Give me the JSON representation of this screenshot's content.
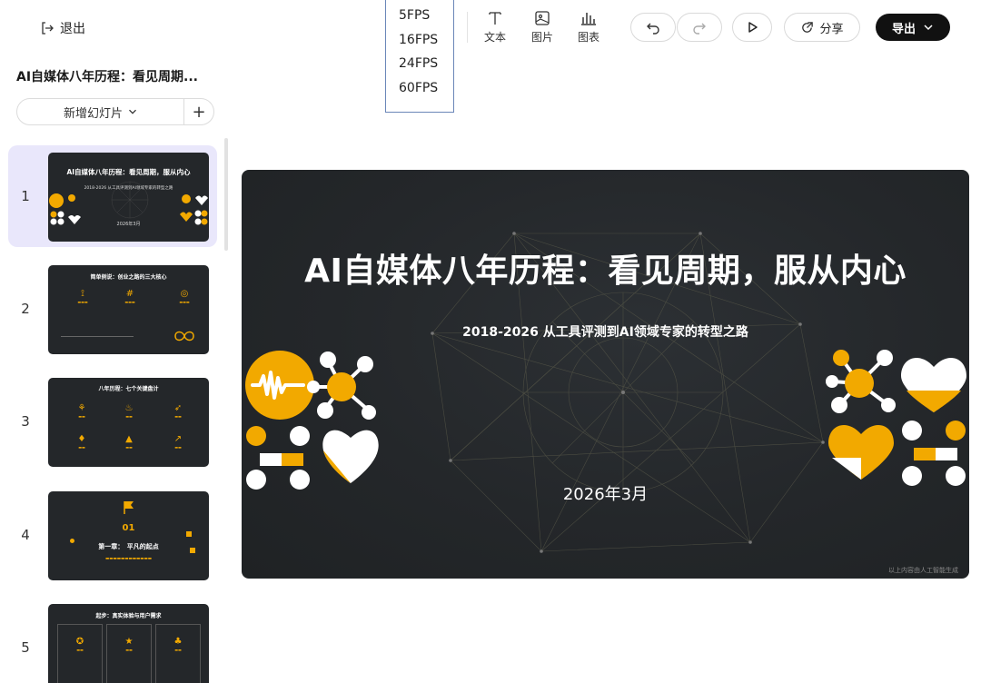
{
  "header": {
    "exit_label": "退出"
  },
  "document": {
    "title": "AI自媒体八年历程：看见周期..."
  },
  "add_slide": {
    "label": "新增幻灯片",
    "plus": "+"
  },
  "fps_menu": {
    "options": [
      "5FPS",
      "16FPS",
      "24FPS",
      "60FPS"
    ]
  },
  "toolbar": {
    "text_label": "文本",
    "image_label": "图片",
    "chart_label": "图表",
    "share_label": "分享",
    "export_label": "导出"
  },
  "slides": [
    {
      "number": "1",
      "title": "AI自媒体八年历程：看见周期，服从内心",
      "subtitle": "2018-2026 从工具评测到AI领域专家的转型之路",
      "date": "2026年3月",
      "selected": true
    },
    {
      "number": "2",
      "title": "简单例说：创业之路的三大核心"
    },
    {
      "number": "3",
      "title": "八年历程：七个关键盘计"
    },
    {
      "number": "4",
      "title": "第一章：　平凡的起点",
      "chapter": "01"
    },
    {
      "number": "5",
      "title": "起步：真实体验与用户需求"
    }
  ],
  "main_slide": {
    "title": "AI自媒体八年历程：看见周期，服从内心",
    "subtitle": "2018-2026 从工具评测到AI领域专家的转型之路",
    "date": "2026年3月",
    "watermark": "以上内容由人工智能生成"
  },
  "colors": {
    "accent": "#f2a900",
    "slide_bg": "#24272a",
    "selection": "#e9e7fb"
  }
}
